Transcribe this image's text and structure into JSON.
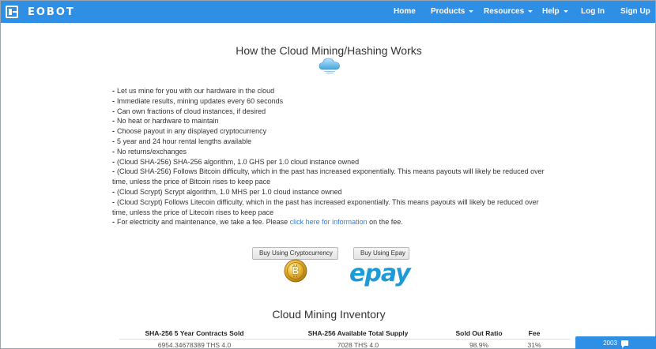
{
  "nav": {
    "brand": "EOBOT",
    "items": [
      {
        "label": "Home",
        "dropdown": false
      },
      {
        "label": "Products",
        "dropdown": true
      },
      {
        "label": "Resources",
        "dropdown": true
      },
      {
        "label": "Help",
        "dropdown": true
      },
      {
        "label": "Log In",
        "dropdown": false
      },
      {
        "label": "Sign Up",
        "dropdown": false
      }
    ],
    "color": "#2f8fe4"
  },
  "main": {
    "title": "How the Cloud Mining/Hashing Works",
    "features": [
      "Let us mine for you with our hardware in the cloud",
      "Immediate results, mining updates every 60 seconds",
      "Can own fractions of cloud instances, if desired",
      "No heat or hardware to maintain",
      "Choose payout in any displayed cryptocurrency",
      "5 year and 24 hour rental lengths available",
      "No returns/exchanges",
      "(Cloud SHA-256) SHA-256 algorithm, 1.0 GHS per 1.0 cloud instance owned",
      "(Cloud SHA-256) Follows Bitcoin difficulty, which in the past has increased exponentially. This means payouts will likely be reduced over time, unless the price of Bitcoin rises to keep pace",
      "(Cloud Scrypt) Scrypt algorithm, 1.0 MHS per 1.0 cloud instance owned",
      "(Cloud Scrypt) Follows Litecoin difficulty, which in the past has increased exponentially. This means payouts will likely be reduced over time, unless the price of Litecoin rises to keep pace"
    ],
    "fee_prefix": "For electricity and maintenance, we take a fee. Please ",
    "fee_link": "click here for information",
    "fee_suffix": " on the fee.",
    "buy_crypto_label": "Buy Using Cryptocurrency",
    "buy_epay_label": "Buy Using Epay",
    "epay_logo_text": "epay"
  },
  "inventory": {
    "title": "Cloud Mining Inventory",
    "headers": [
      "SHA-256 5 Year Contracts Sold",
      "SHA-256 Available Total Supply",
      "Sold Out Ratio",
      "Fee"
    ],
    "row": [
      "6954.34678389 THS 4.0",
      "7028 THS 4.0",
      "98.9%",
      "31%"
    ]
  },
  "chat": {
    "count": "2003"
  }
}
